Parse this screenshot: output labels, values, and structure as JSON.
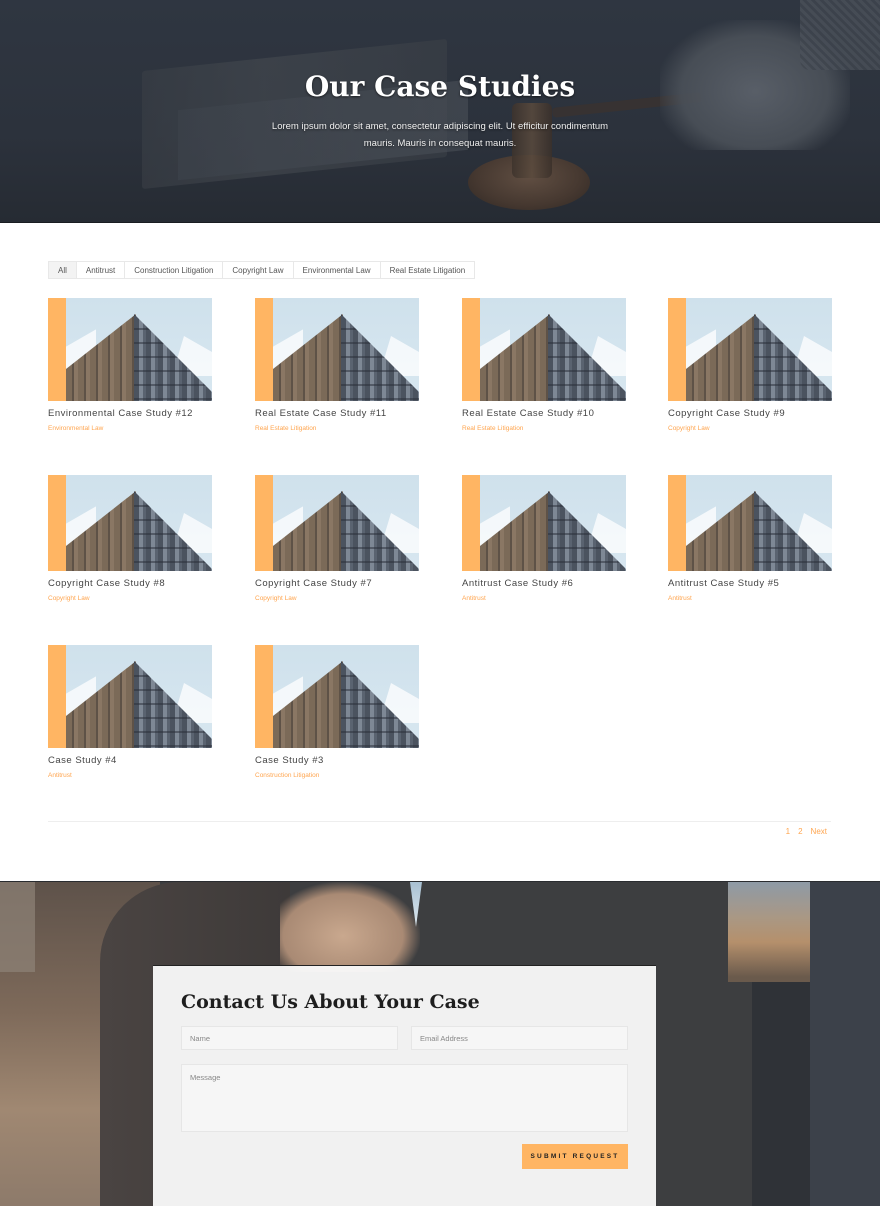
{
  "hero": {
    "title": "Our Case Studies",
    "subtitle": "Lorem ipsum dolor sit amet, consectetur adipiscing elit. Ut efficitur condimentum mauris. Mauris in consequat mauris."
  },
  "filters": [
    {
      "label": "All",
      "active": true
    },
    {
      "label": "Antitrust",
      "active": false
    },
    {
      "label": "Construction Litigation",
      "active": false
    },
    {
      "label": "Copyright Law",
      "active": false
    },
    {
      "label": "Environmental Law",
      "active": false
    },
    {
      "label": "Real Estate Litigation",
      "active": false
    }
  ],
  "case_studies": [
    {
      "title": "Environmental Case Study #12",
      "category": "Environmental Law"
    },
    {
      "title": "Real Estate Case Study #11",
      "category": "Real Estate Litigation"
    },
    {
      "title": "Real Estate Case Study #10",
      "category": "Real Estate Litigation"
    },
    {
      "title": "Copyright Case Study #9",
      "category": "Copyright Law"
    },
    {
      "title": "Copyright Case Study #8",
      "category": "Copyright Law"
    },
    {
      "title": "Copyright Case Study #7",
      "category": "Copyright Law"
    },
    {
      "title": "Antitrust Case Study #6",
      "category": "Antitrust"
    },
    {
      "title": "Antitrust Case Study #5",
      "category": "Antitrust"
    },
    {
      "title": "Case Study #4",
      "category": "Antitrust"
    },
    {
      "title": "Case Study #3",
      "category": "Construction Litigation"
    }
  ],
  "pagination": {
    "pages": [
      "1",
      "2"
    ],
    "next_label": "Next"
  },
  "contact": {
    "title": "Contact Us About Your Case",
    "name_placeholder": "Name",
    "email_placeholder": "Email Address",
    "message_placeholder": "Message",
    "submit_label": "SUBMIT REQUEST"
  },
  "colors": {
    "accent": "#ffb563",
    "category_text": "#ffa54f",
    "hero_bg": "#2f3641"
  }
}
